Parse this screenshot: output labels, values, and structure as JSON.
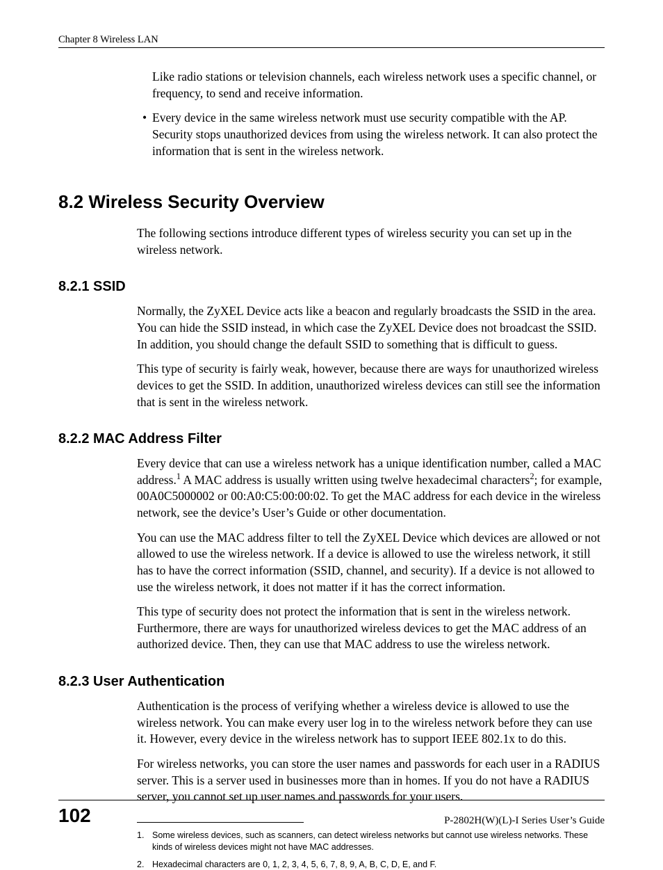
{
  "header": {
    "chapter": "Chapter 8 Wireless LAN"
  },
  "intro": {
    "para_channel": "Like radio stations or television channels, each wireless network uses a specific channel, or frequency, to send and receive information.",
    "bullet_security": "Every device in the same wireless network must use security compatible with the AP. Security stops unauthorized devices from using the wireless network. It can also protect the information that is sent in the wireless network."
  },
  "sec82": {
    "heading": "8.2  Wireless Security Overview",
    "para": "The following sections introduce different types of wireless security you can set up in the wireless network."
  },
  "sec821": {
    "heading": "8.2.1  SSID",
    "p1": "Normally, the ZyXEL Device acts like a beacon and regularly broadcasts the SSID in the area. You can hide the SSID instead, in which case the ZyXEL Device does not broadcast the SSID. In addition, you should change the default SSID to something that is difficult to guess.",
    "p2": "This type of security is fairly weak, however, because there are ways for unauthorized wireless devices to get the SSID. In addition, unauthorized wireless devices can still see the information that is sent in the wireless network."
  },
  "sec822": {
    "heading": "8.2.2  MAC Address Filter",
    "p1_pre": "Every device that can use a wireless network has a unique identification number, called a MAC address.",
    "p1_mid": " A MAC address is usually written using twelve hexadecimal characters",
    "p1_post": "; for example, 00A0C5000002 or 00:A0:C5:00:00:02. To get the MAC address for each device in the wireless network, see the device’s User’s Guide or other documentation.",
    "p2": "You can use the MAC address filter to tell the ZyXEL Device which devices are allowed or not allowed to use the wireless network. If a device is allowed to use the wireless network, it still has to have the correct information (SSID, channel, and security). If a device is not allowed to use the wireless network, it does not matter if it has the correct information.",
    "p3": "This type of security does not protect the information that is sent in the wireless network. Furthermore, there are ways for unauthorized wireless devices to get the MAC address of an authorized device. Then, they can use that MAC address to use the wireless network."
  },
  "sec823": {
    "heading": "8.2.3  User Authentication",
    "p1": "Authentication is the process of verifying whether a wireless device is allowed to use the wireless network. You can make every user log in to the wireless network before they can use it. However, every device in the wireless network has to support IEEE 802.1x to do this.",
    "p2": "For wireless networks, you can store the user names and passwords for each user in a RADIUS server. This is a server used in businesses more than in homes. If you do not have a RADIUS server, you cannot set up user names and passwords for your users."
  },
  "footnotes": {
    "n1": "1.",
    "t1": "Some wireless devices, such as scanners, can detect wireless networks but cannot use wireless networks. These kinds of wireless devices might not have MAC addresses.",
    "n2": "2.",
    "t2": "Hexadecimal characters are 0, 1, 2, 3, 4, 5, 6, 7, 8, 9, A, B, C, D, E, and F."
  },
  "footer": {
    "page": "102",
    "guide": "P-2802H(W)(L)-I Series User’s Guide"
  },
  "super": {
    "one": "1",
    "two": "2"
  }
}
